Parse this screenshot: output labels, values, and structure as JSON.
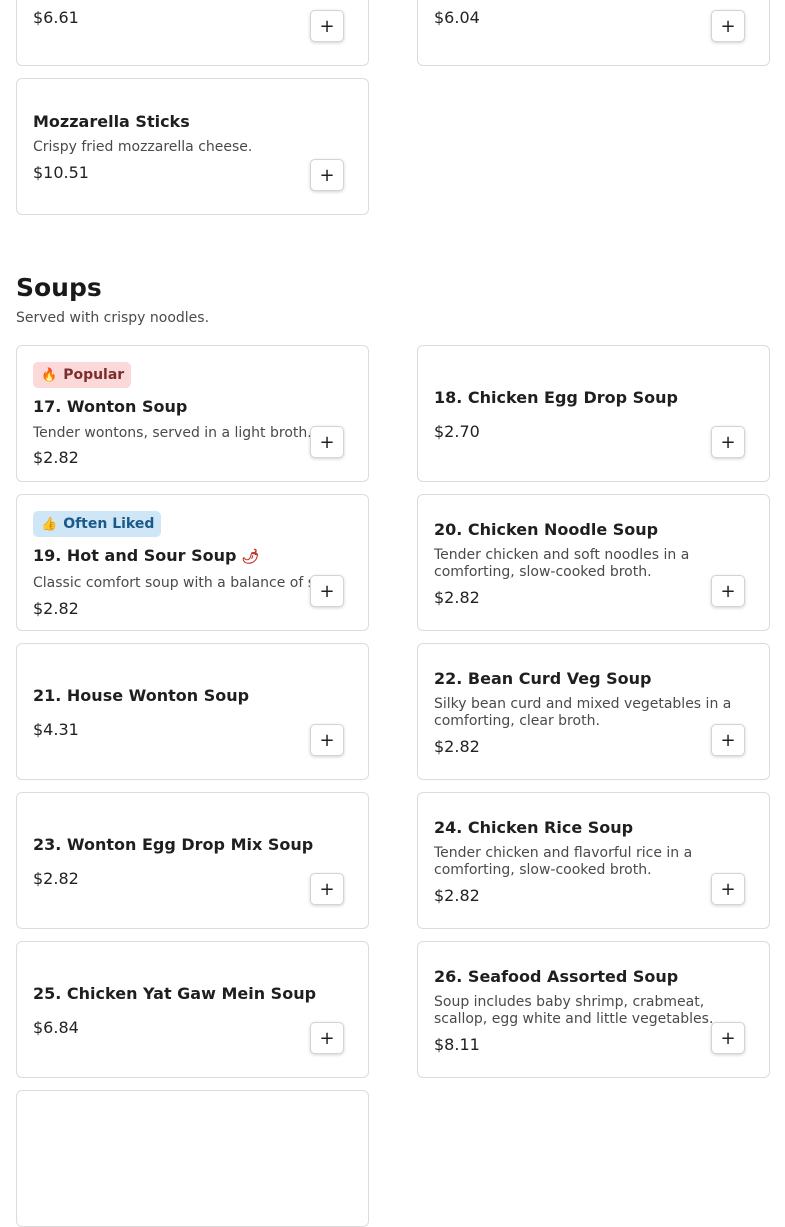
{
  "top_cards": {
    "left": {
      "price": "$6.61",
      "add_label": "+"
    },
    "right": {
      "price": "$6.04",
      "add_label": "+"
    },
    "mozzarella": {
      "name": "Mozzarella Sticks",
      "desc": "Crispy fried mozzarella cheese.",
      "price": "$10.51",
      "add_label": "+"
    }
  },
  "soups": {
    "title": "Soups",
    "subtitle": "Served with crispy noodles.",
    "items": [
      {
        "badge": "Popular",
        "name": "17. Wonton Soup",
        "desc": "Tender wontons, served in a light broth.",
        "price": "$2.82",
        "add_label": "+"
      },
      {
        "name": "18. Chicken Egg Drop Soup",
        "price": "$2.70",
        "add_label": "+"
      },
      {
        "badge": "Often Liked",
        "name": "19. Hot and Sour Soup",
        "desc": "Classic comfort soup with a balance of s….",
        "price": "$2.82",
        "add_label": "+"
      },
      {
        "name": "20. Chicken Noodle Soup",
        "desc": "Tender chicken and soft noodles in a comforting, slow-cooked broth.",
        "price": "$2.82",
        "add_label": "+"
      },
      {
        "name": "21. House Wonton Soup",
        "price": "$4.31",
        "add_label": "+"
      },
      {
        "name": "22. Bean Curd Veg Soup",
        "desc": "Silky bean curd and mixed vegetables in a comforting, clear broth.",
        "price": "$2.82",
        "add_label": "+"
      },
      {
        "name": "23. Wonton Egg Drop Mix Soup",
        "price": "$2.82",
        "add_label": "+"
      },
      {
        "name": "24. Chicken Rice Soup",
        "desc": "Tender chicken and flavorful rice in a comforting, slow-cooked broth.",
        "price": "$2.82",
        "add_label": "+"
      },
      {
        "name": "25. Chicken Yat Gaw Mein Soup",
        "price": "$6.84",
        "add_label": "+"
      },
      {
        "name": "26. Seafood Assorted Soup",
        "desc": "Soup includes baby shrimp, crabmeat, scallop, egg white and little vegetables.",
        "price": "$8.11",
        "add_label": "+"
      }
    ]
  },
  "icons": {
    "popular": "flame-icon",
    "often_liked": "thumbs-up-icon",
    "spicy": "chili-icon"
  },
  "colors": {
    "popular_bg": "#fcd9d9",
    "popular_text": "#7a2e2e",
    "liked_bg": "#cfe6f7",
    "liked_text": "#1a5a8a",
    "spicy": "#c0392b"
  }
}
